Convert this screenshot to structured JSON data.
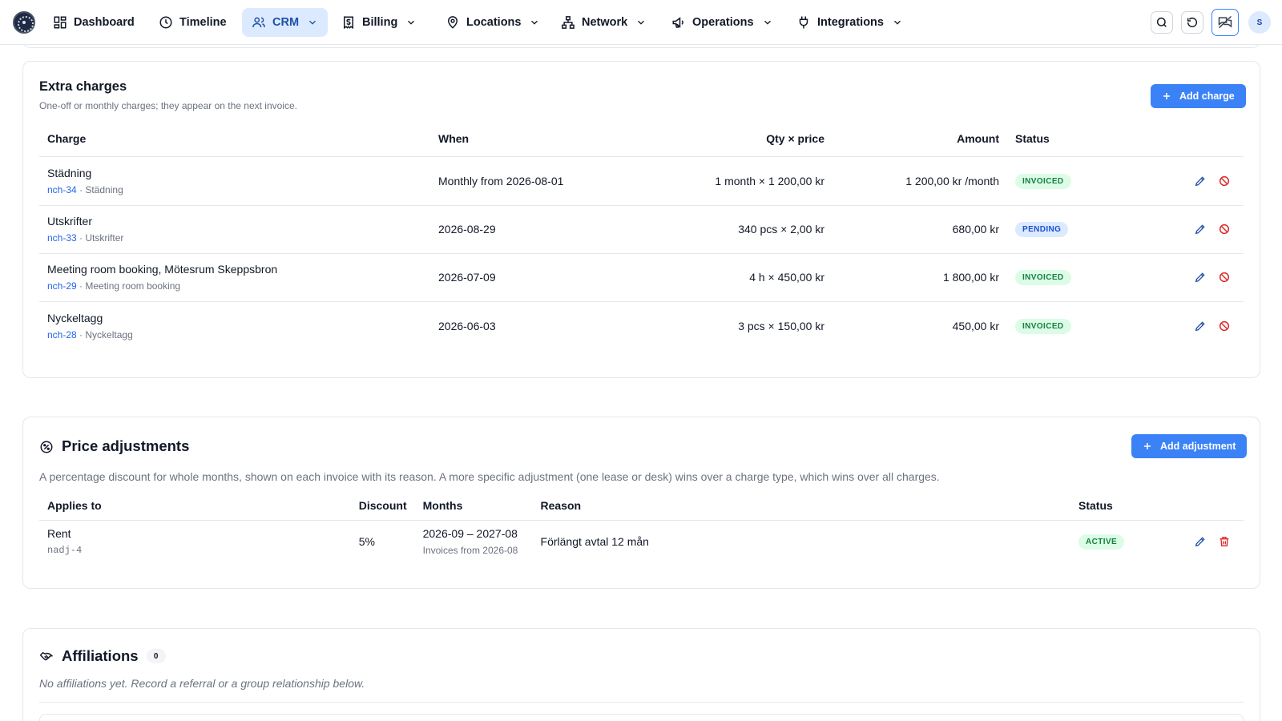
{
  "nav": {
    "items": [
      {
        "label": "Dashboard"
      },
      {
        "label": "Timeline"
      },
      {
        "label": "CRM"
      },
      {
        "label": "Billing"
      },
      {
        "label": "Locations"
      },
      {
        "label": "Network"
      },
      {
        "label": "Operations"
      },
      {
        "label": "Integrations"
      }
    ],
    "avatar_initial": "S"
  },
  "extra_charges": {
    "title": "Extra charges",
    "subtitle": "One-off or monthly charges; they appear on the next invoice.",
    "add_label": "Add charge",
    "columns": [
      "Charge",
      "When",
      "Qty × price",
      "Amount",
      "Status"
    ],
    "rows": [
      {
        "name": "Städning",
        "ref": "nch-34",
        "type": "Städning",
        "when": "Monthly from 2026-08-01",
        "qty_price": "1 month × 1 200,00 kr",
        "amount": "1 200,00 kr /month",
        "status": "INVOICED"
      },
      {
        "name": "Utskrifter",
        "ref": "nch-33",
        "type": "Utskrifter",
        "when": "2026-08-29",
        "qty_price": "340 pcs × 2,00 kr",
        "amount": "680,00 kr",
        "status": "PENDING"
      },
      {
        "name": "Meeting room booking, Mötesrum Skeppsbron",
        "ref": "nch-29",
        "type": "Meeting room booking",
        "when": "2026-07-09",
        "qty_price": "4 h × 450,00 kr",
        "amount": "1 800,00 kr",
        "status": "INVOICED"
      },
      {
        "name": "Nyckeltagg",
        "ref": "nch-28",
        "type": "Nyckeltagg",
        "when": "2026-06-03",
        "qty_price": "3 pcs × 150,00 kr",
        "amount": "450,00 kr",
        "status": "INVOICED"
      }
    ],
    "separator": " · "
  },
  "price_adjustments": {
    "title": "Price adjustments",
    "description": "A percentage discount for whole months, shown on each invoice with its reason. A more specific adjustment (one lease or desk) wins over a charge type, which wins over all charges.",
    "add_label": "Add adjustment",
    "columns": [
      "Applies to",
      "Discount",
      "Months",
      "Reason",
      "Status"
    ],
    "rows": [
      {
        "applies_to": "Rent",
        "id": "nadj-4",
        "discount": "5%",
        "months": "2026-09 – 2027-08",
        "months_note": "Invoices from 2026-08",
        "reason": "Förlängt avtal 12 mån",
        "status": "ACTIVE"
      }
    ]
  },
  "affiliations": {
    "title": "Affiliations",
    "count": "0",
    "empty_text": "No affiliations yet. Record a referral or a group relationship below."
  },
  "colors": {
    "accent": "#3b82f6",
    "success": "#15803d",
    "danger": "#dc2626"
  }
}
